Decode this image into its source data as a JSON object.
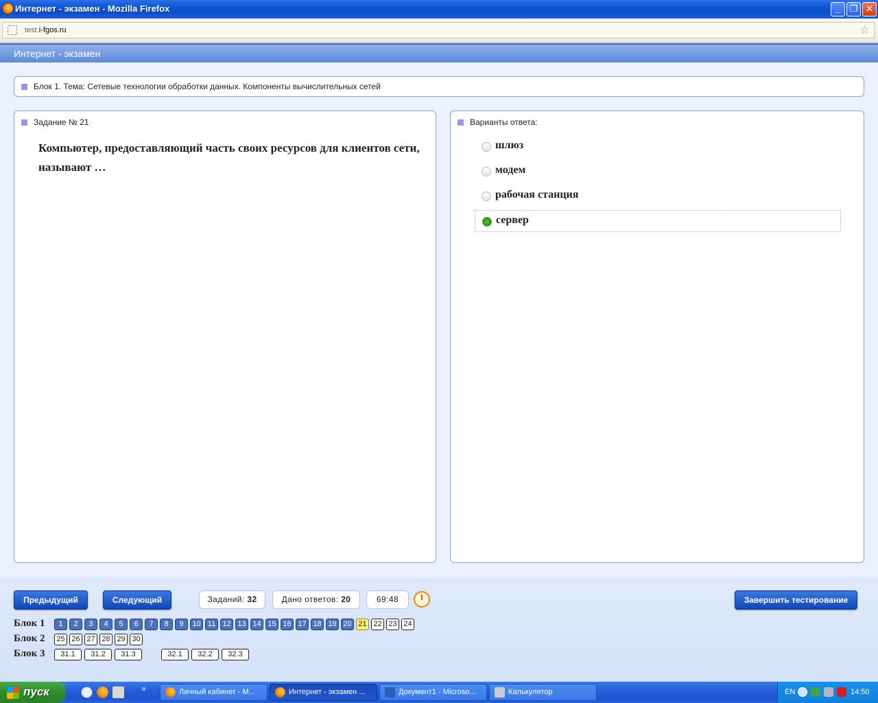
{
  "window": {
    "title": "Интернет - экзамен - Mozilla Firefox",
    "minimize": "_",
    "maximize": "❐",
    "close": "✕"
  },
  "browser": {
    "url_host_prefix": "test.",
    "url_domain": "i-fgos.ru"
  },
  "page": {
    "header": "Интернет - экзамен",
    "block_topic": "Блок 1. Тема: Сетевые технологии обработки данных. Компоненты вычислительных сетей",
    "task_label": "Задание № 21",
    "question": "Компьютер, предоставляющий часть своих ресурсов для клиентов сети, называют …",
    "answers_label": "Варианты ответа:",
    "options": [
      {
        "text": "шлюз",
        "selected": false
      },
      {
        "text": "модем",
        "selected": false
      },
      {
        "text": "рабочая станция",
        "selected": false
      },
      {
        "text": "сервер",
        "selected": true
      }
    ]
  },
  "footer": {
    "prev_label": "Предыдущий",
    "next_label": "Следующий",
    "tasks_label": "Заданий:",
    "tasks_value": "32",
    "answers_given_label": "Дано ответов:",
    "answers_given_value": "20",
    "timer": "69:48",
    "finish_label": "Завершить тестирование",
    "blocks": [
      {
        "label": "Блок 1",
        "items": [
          {
            "n": "1",
            "s": "answered"
          },
          {
            "n": "2",
            "s": "answered"
          },
          {
            "n": "3",
            "s": "answered"
          },
          {
            "n": "4",
            "s": "answered"
          },
          {
            "n": "5",
            "s": "answered"
          },
          {
            "n": "6",
            "s": "answered"
          },
          {
            "n": "7",
            "s": "answered"
          },
          {
            "n": "8",
            "s": "answered"
          },
          {
            "n": "9",
            "s": "answered"
          },
          {
            "n": "10",
            "s": "answered"
          },
          {
            "n": "11",
            "s": "answered"
          },
          {
            "n": "12",
            "s": "answered"
          },
          {
            "n": "13",
            "s": "answered"
          },
          {
            "n": "14",
            "s": "answered"
          },
          {
            "n": "15",
            "s": "answered"
          },
          {
            "n": "16",
            "s": "answered"
          },
          {
            "n": "17",
            "s": "answered"
          },
          {
            "n": "18",
            "s": "answered"
          },
          {
            "n": "19",
            "s": "answered"
          },
          {
            "n": "20",
            "s": "answered"
          },
          {
            "n": "21",
            "s": "current"
          },
          {
            "n": "22",
            "s": "open"
          },
          {
            "n": "23",
            "s": "open"
          },
          {
            "n": "24",
            "s": "open"
          }
        ]
      },
      {
        "label": "Блок 2",
        "items": [
          {
            "n": "25",
            "s": "open"
          },
          {
            "n": "26",
            "s": "open"
          },
          {
            "n": "27",
            "s": "open"
          },
          {
            "n": "28",
            "s": "open"
          },
          {
            "n": "29",
            "s": "open"
          },
          {
            "n": "30",
            "s": "open"
          }
        ]
      },
      {
        "label": "Блок 3",
        "items": [
          {
            "n": "31.1",
            "s": "open"
          },
          {
            "n": "31.2",
            "s": "open"
          },
          {
            "n": "31.3",
            "s": "open"
          },
          {
            "n": "32.1",
            "s": "open"
          },
          {
            "n": "32.2",
            "s": "open"
          },
          {
            "n": "32.3",
            "s": "open"
          }
        ]
      }
    ]
  },
  "taskbar": {
    "start_label": "пуск",
    "tasks": [
      {
        "label": "Личный кабинет - М...",
        "icon": "firefox-icon",
        "active": false
      },
      {
        "label": "Интернет - экзамен ...",
        "icon": "firefox-icon",
        "active": true
      },
      {
        "label": "Документ1 - Microso...",
        "icon": "word-icon",
        "active": false
      },
      {
        "label": "Калькулятор",
        "icon": "calculator-icon",
        "active": false
      }
    ],
    "language": "EN",
    "clock": "14:50"
  },
  "colors": {
    "answered": "#4b72bb",
    "current": "#f7f07a",
    "accent": "#1149b8",
    "bullet": "#9d93ea"
  }
}
